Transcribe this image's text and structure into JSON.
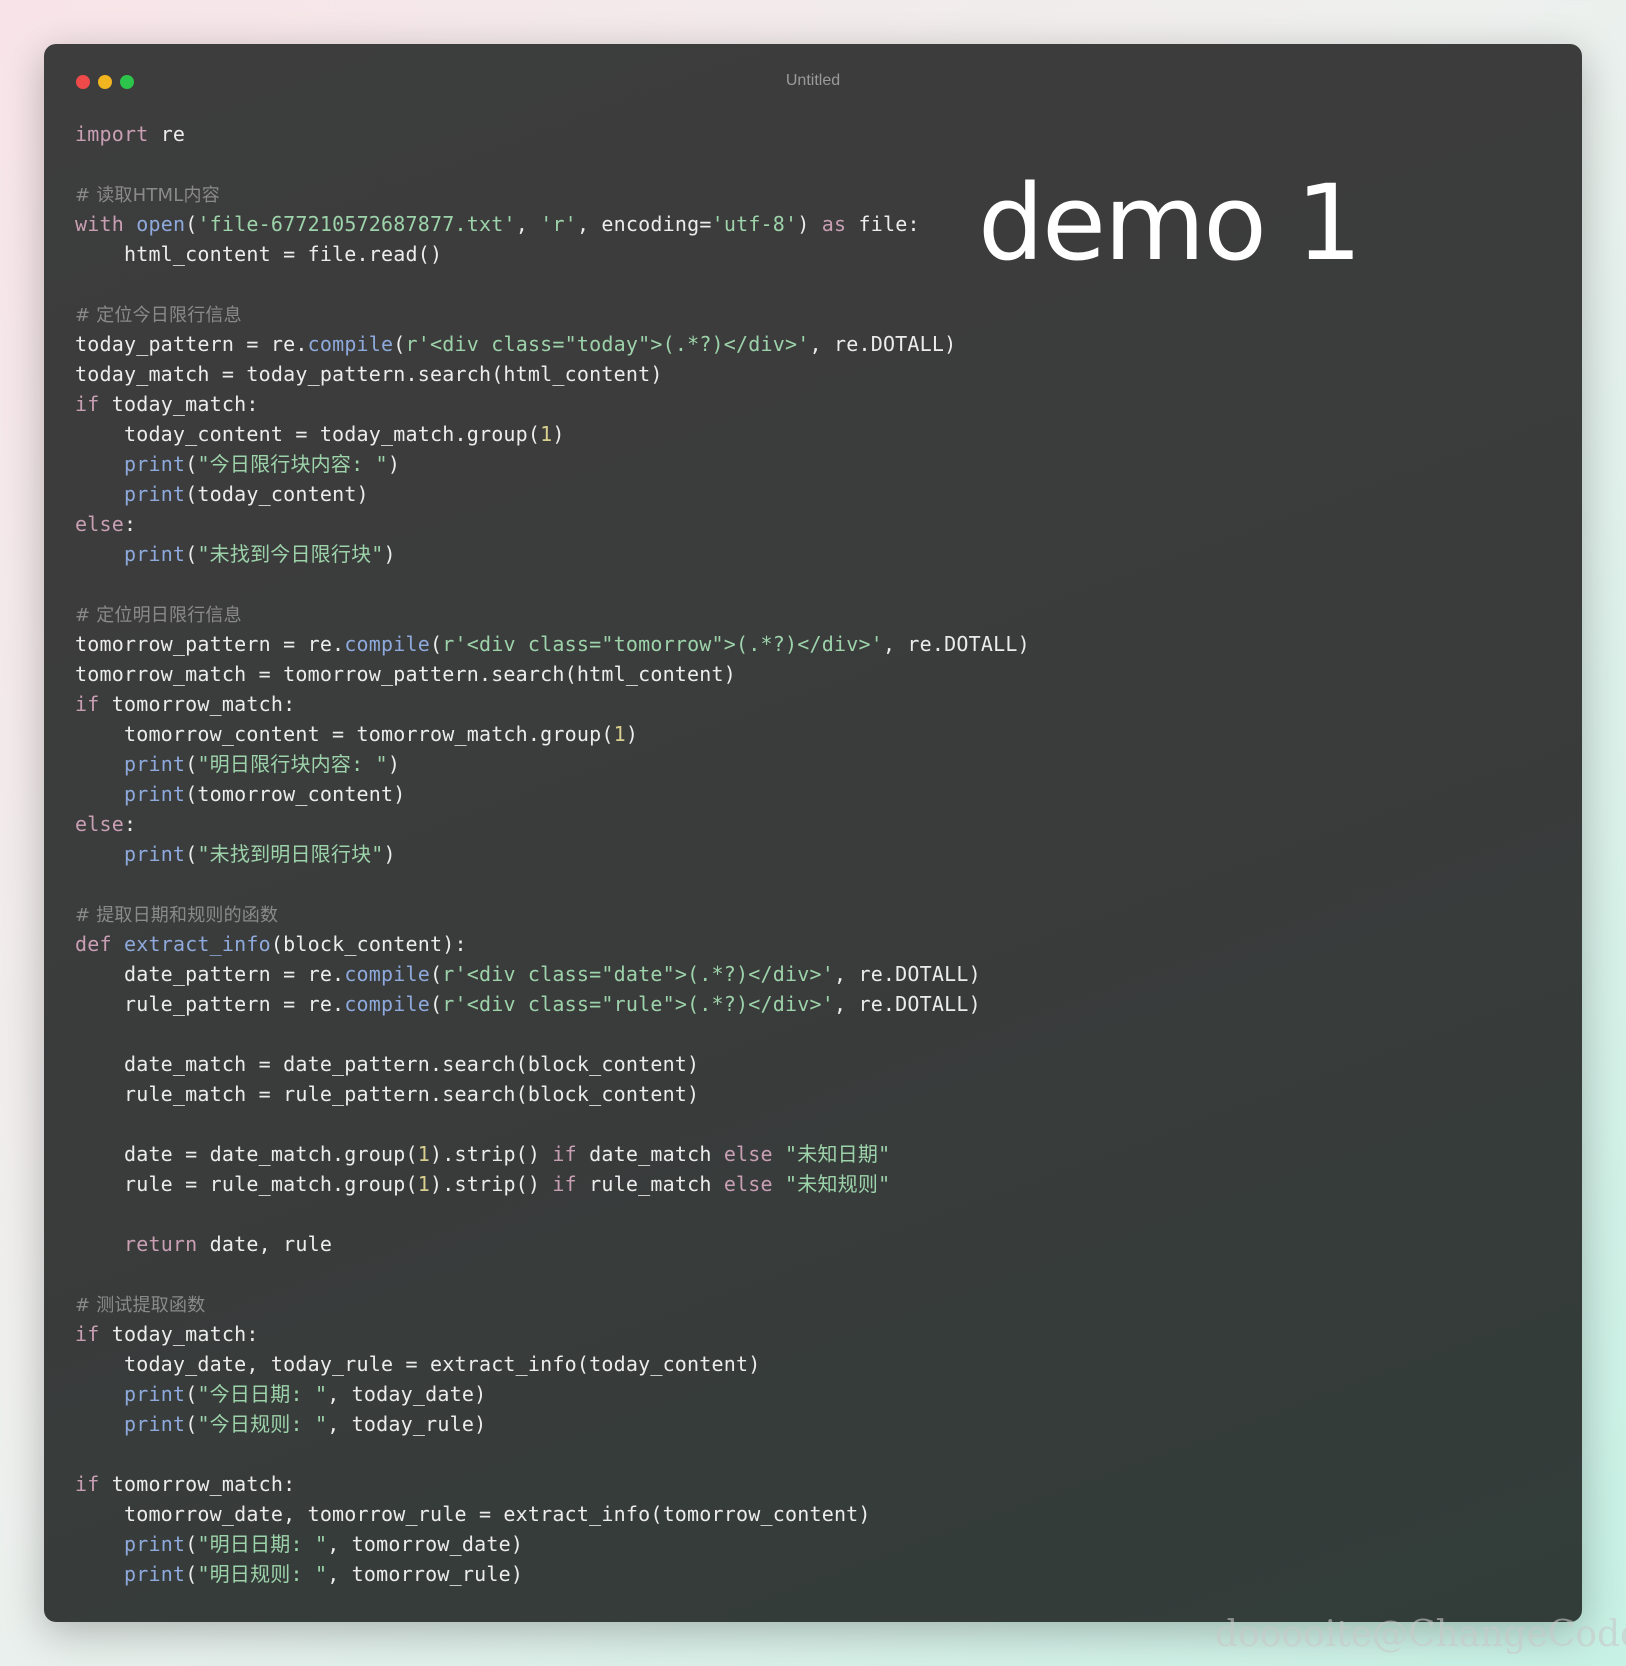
{
  "window": {
    "title": "Untitled",
    "traffic_lights": {
      "close": "#ee4a4a",
      "minimize": "#f2b51f",
      "maximize": "#2cc44a"
    }
  },
  "overlay_text": "demo 1",
  "watermark": "dooooite@ChangeCode",
  "syntax_colors": {
    "keyword": "#c99fb4",
    "function": "#8ea9dc",
    "string": "#9dd3aa",
    "number": "#d9cf8e",
    "comment": "#8a8a8a",
    "plain": "#ececec"
  },
  "code_lines": [
    [
      [
        "k",
        "import"
      ],
      [
        "p",
        " re"
      ]
    ],
    [],
    [
      [
        "c",
        "# 读取HTML内容"
      ]
    ],
    [
      [
        "k",
        "with"
      ],
      [
        "p",
        " "
      ],
      [
        "f",
        "open"
      ],
      [
        "p",
        "("
      ],
      [
        "s",
        "'file-677210572687877.txt'"
      ],
      [
        "p",
        ", "
      ],
      [
        "s",
        "'r'"
      ],
      [
        "p",
        ", encoding="
      ],
      [
        "s",
        "'utf-8'"
      ],
      [
        "p",
        ") "
      ],
      [
        "k",
        "as"
      ],
      [
        "p",
        " file:"
      ]
    ],
    [
      [
        "p",
        "    html_content = file.read()"
      ]
    ],
    [],
    [
      [
        "c",
        "# 定位今日限行信息"
      ]
    ],
    [
      [
        "p",
        "today_pattern = re."
      ],
      [
        "f",
        "compile"
      ],
      [
        "p",
        "("
      ],
      [
        "s",
        "r'<div class=\"today\">(.*?)</div>'"
      ],
      [
        "p",
        ", re.DOTALL)"
      ]
    ],
    [
      [
        "p",
        "today_match = today_pattern.search(html_content)"
      ]
    ],
    [
      [
        "k",
        "if"
      ],
      [
        "p",
        " today_match:"
      ]
    ],
    [
      [
        "p",
        "    today_content = today_match.group("
      ],
      [
        "n",
        "1"
      ],
      [
        "p",
        ")"
      ]
    ],
    [
      [
        "p",
        "    "
      ],
      [
        "f",
        "print"
      ],
      [
        "p",
        "("
      ],
      [
        "s",
        "\"今日限行块内容: \""
      ],
      [
        "p",
        ")"
      ]
    ],
    [
      [
        "p",
        "    "
      ],
      [
        "f",
        "print"
      ],
      [
        "p",
        "(today_content)"
      ]
    ],
    [
      [
        "k",
        "else"
      ],
      [
        "p",
        ":"
      ]
    ],
    [
      [
        "p",
        "    "
      ],
      [
        "f",
        "print"
      ],
      [
        "p",
        "("
      ],
      [
        "s",
        "\"未找到今日限行块\""
      ],
      [
        "p",
        ")"
      ]
    ],
    [],
    [
      [
        "c",
        "# 定位明日限行信息"
      ]
    ],
    [
      [
        "p",
        "tomorrow_pattern = re."
      ],
      [
        "f",
        "compile"
      ],
      [
        "p",
        "("
      ],
      [
        "s",
        "r'<div class=\"tomorrow\">(.*?)</div>'"
      ],
      [
        "p",
        ", re.DOTALL)"
      ]
    ],
    [
      [
        "p",
        "tomorrow_match = tomorrow_pattern.search(html_content)"
      ]
    ],
    [
      [
        "k",
        "if"
      ],
      [
        "p",
        " tomorrow_match:"
      ]
    ],
    [
      [
        "p",
        "    tomorrow_content = tomorrow_match.group("
      ],
      [
        "n",
        "1"
      ],
      [
        "p",
        ")"
      ]
    ],
    [
      [
        "p",
        "    "
      ],
      [
        "f",
        "print"
      ],
      [
        "p",
        "("
      ],
      [
        "s",
        "\"明日限行块内容: \""
      ],
      [
        "p",
        ")"
      ]
    ],
    [
      [
        "p",
        "    "
      ],
      [
        "f",
        "print"
      ],
      [
        "p",
        "(tomorrow_content)"
      ]
    ],
    [
      [
        "k",
        "else"
      ],
      [
        "p",
        ":"
      ]
    ],
    [
      [
        "p",
        "    "
      ],
      [
        "f",
        "print"
      ],
      [
        "p",
        "("
      ],
      [
        "s",
        "\"未找到明日限行块\""
      ],
      [
        "p",
        ")"
      ]
    ],
    [],
    [
      [
        "c",
        "# 提取日期和规则的函数"
      ]
    ],
    [
      [
        "k",
        "def"
      ],
      [
        "p",
        " "
      ],
      [
        "f",
        "extract_info"
      ],
      [
        "p",
        "(block_content):"
      ]
    ],
    [
      [
        "p",
        "    date_pattern = re."
      ],
      [
        "f",
        "compile"
      ],
      [
        "p",
        "("
      ],
      [
        "s",
        "r'<div class=\"date\">(.*?)</div>'"
      ],
      [
        "p",
        ", re.DOTALL)"
      ]
    ],
    [
      [
        "p",
        "    rule_pattern = re."
      ],
      [
        "f",
        "compile"
      ],
      [
        "p",
        "("
      ],
      [
        "s",
        "r'<div class=\"rule\">(.*?)</div>'"
      ],
      [
        "p",
        ", re.DOTALL)"
      ]
    ],
    [],
    [
      [
        "p",
        "    date_match = date_pattern.search(block_content)"
      ]
    ],
    [
      [
        "p",
        "    rule_match = rule_pattern.search(block_content)"
      ]
    ],
    [],
    [
      [
        "p",
        "    date = date_match.group("
      ],
      [
        "n",
        "1"
      ],
      [
        "p",
        ").strip() "
      ],
      [
        "k",
        "if"
      ],
      [
        "p",
        " date_match "
      ],
      [
        "k",
        "else"
      ],
      [
        "p",
        " "
      ],
      [
        "s",
        "\"未知日期\""
      ]
    ],
    [
      [
        "p",
        "    rule = rule_match.group("
      ],
      [
        "n",
        "1"
      ],
      [
        "p",
        ").strip() "
      ],
      [
        "k",
        "if"
      ],
      [
        "p",
        " rule_match "
      ],
      [
        "k",
        "else"
      ],
      [
        "p",
        " "
      ],
      [
        "s",
        "\"未知规则\""
      ]
    ],
    [],
    [
      [
        "p",
        "    "
      ],
      [
        "k",
        "return"
      ],
      [
        "p",
        " date, rule"
      ]
    ],
    [],
    [
      [
        "c",
        "# 测试提取函数"
      ]
    ],
    [
      [
        "k",
        "if"
      ],
      [
        "p",
        " today_match:"
      ]
    ],
    [
      [
        "p",
        "    today_date, today_rule = extract_info(today_content)"
      ]
    ],
    [
      [
        "p",
        "    "
      ],
      [
        "f",
        "print"
      ],
      [
        "p",
        "("
      ],
      [
        "s",
        "\"今日日期: \""
      ],
      [
        "p",
        ", today_date)"
      ]
    ],
    [
      [
        "p",
        "    "
      ],
      [
        "f",
        "print"
      ],
      [
        "p",
        "("
      ],
      [
        "s",
        "\"今日规则: \""
      ],
      [
        "p",
        ", today_rule)"
      ]
    ],
    [],
    [
      [
        "k",
        "if"
      ],
      [
        "p",
        " tomorrow_match:"
      ]
    ],
    [
      [
        "p",
        "    tomorrow_date, tomorrow_rule = extract_info(tomorrow_content)"
      ]
    ],
    [
      [
        "p",
        "    "
      ],
      [
        "f",
        "print"
      ],
      [
        "p",
        "("
      ],
      [
        "s",
        "\"明日日期: \""
      ],
      [
        "p",
        ", tomorrow_date)"
      ]
    ],
    [
      [
        "p",
        "    "
      ],
      [
        "f",
        "print"
      ],
      [
        "p",
        "("
      ],
      [
        "s",
        "\"明日规则: \""
      ],
      [
        "p",
        ", tomorrow_rule)"
      ]
    ]
  ]
}
